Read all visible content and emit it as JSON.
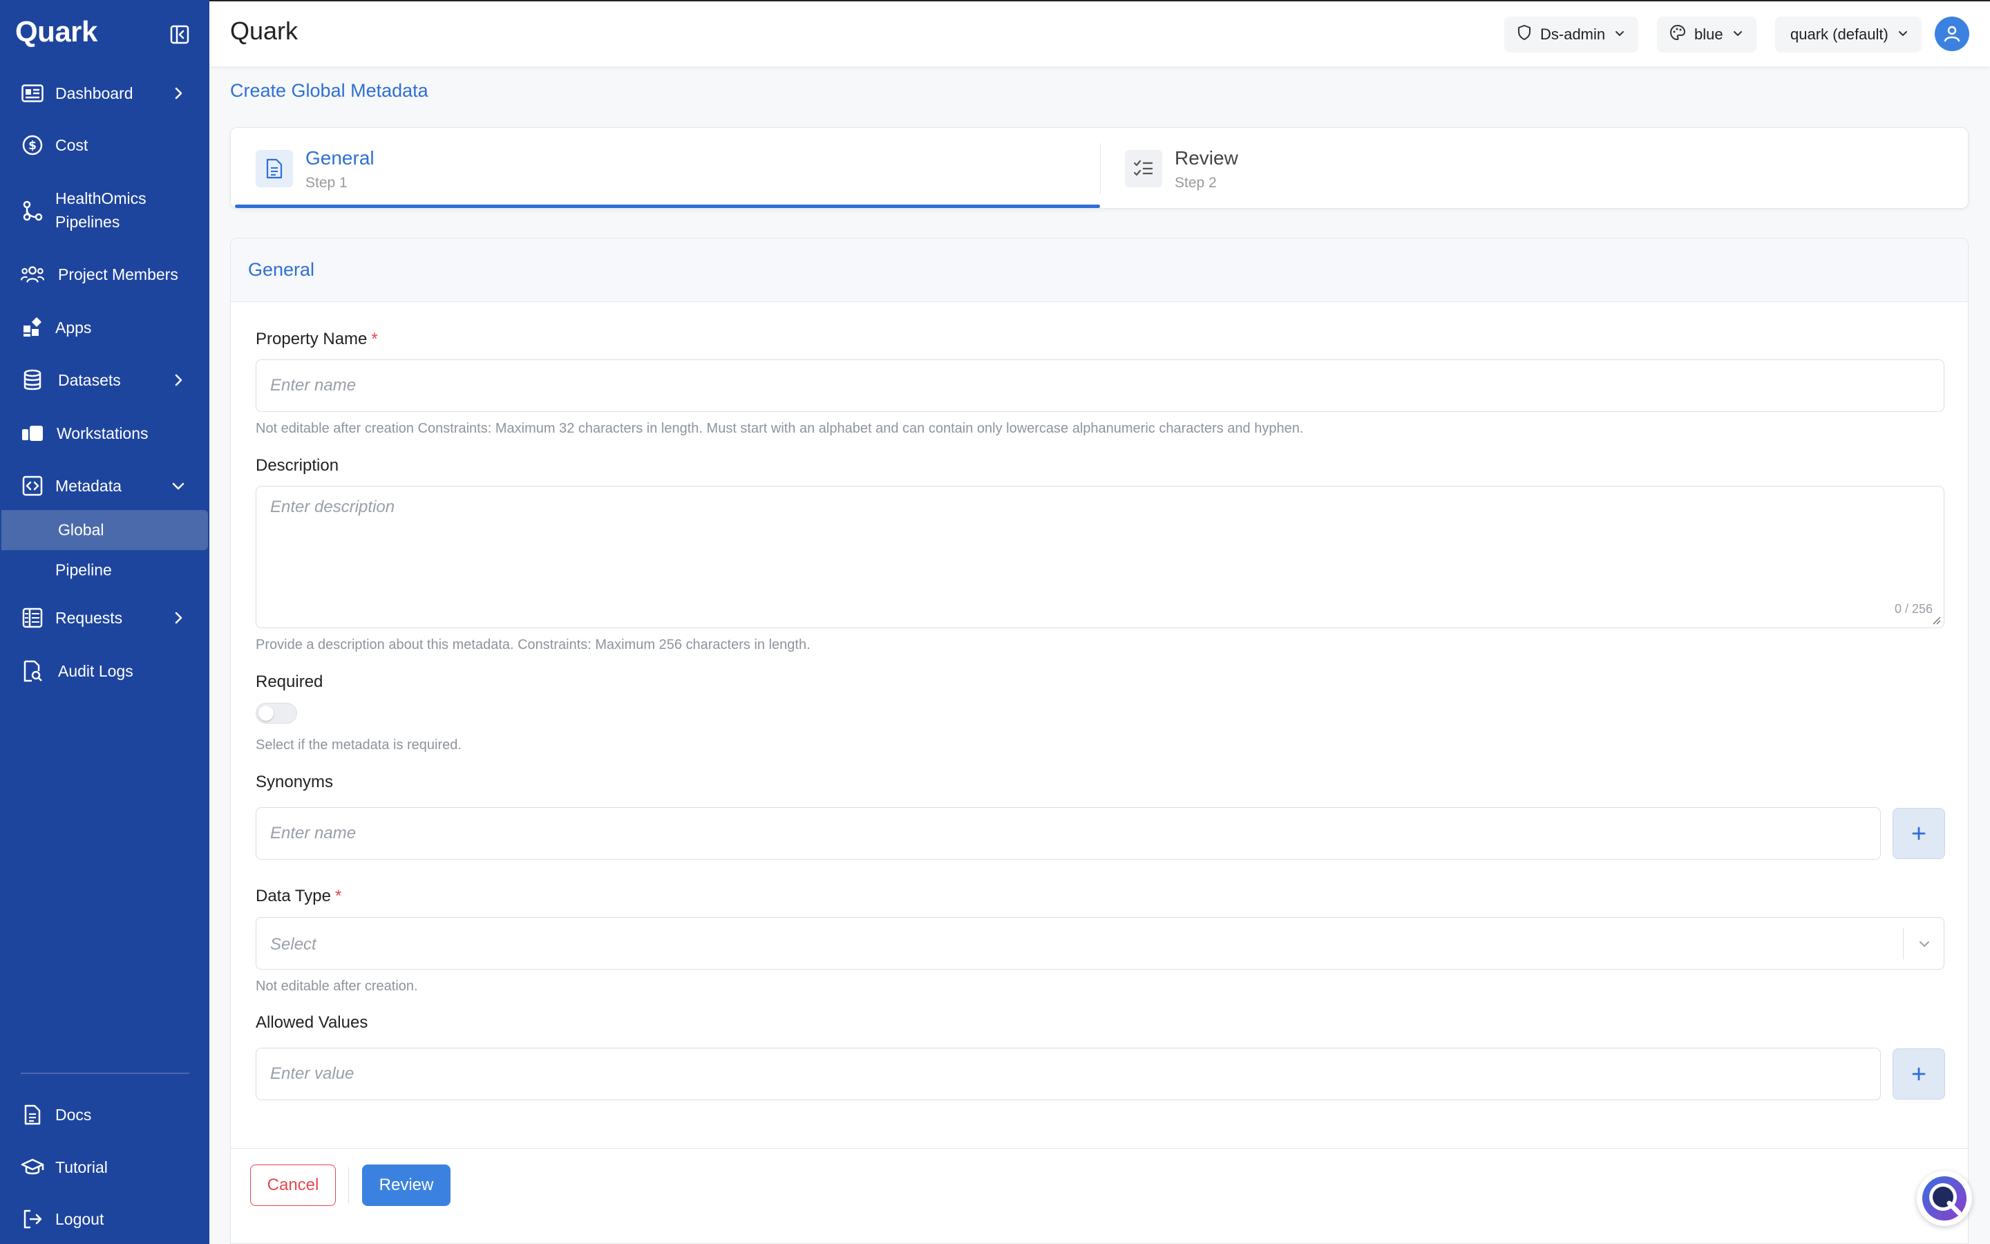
{
  "sidebar": {
    "brand": "Quark",
    "items": [
      {
        "label": "Dashboard",
        "icon": "dashboard-icon"
      },
      {
        "label": "Cost",
        "icon": "dollar-icon"
      },
      {
        "label": "HealthOmics Pipelines",
        "icon": "pipeline-icon"
      },
      {
        "label": "Project Members",
        "icon": "users-icon"
      },
      {
        "label": "Apps",
        "icon": "apps-icon"
      },
      {
        "label": "Datasets",
        "icon": "database-icon"
      },
      {
        "label": "Workstations",
        "icon": "workstation-icon"
      },
      {
        "label": "Metadata",
        "icon": "code-icon"
      },
      {
        "label": "Requests",
        "icon": "list-icon"
      },
      {
        "label": "Audit Logs",
        "icon": "audit-icon"
      }
    ],
    "metadata_sub": [
      {
        "label": "Global",
        "active": true
      },
      {
        "label": "Pipeline",
        "active": false
      }
    ],
    "bottom_items": [
      {
        "label": "Docs",
        "icon": "doc-icon"
      },
      {
        "label": "Tutorial",
        "icon": "graduation-icon"
      },
      {
        "label": "Logout",
        "icon": "logout-icon"
      }
    ]
  },
  "header": {
    "title": "Quark",
    "role": "Ds-admin",
    "theme": "blue",
    "project": "quark (default)"
  },
  "breadcrumb": "Create Global Metadata",
  "stepper": {
    "steps": [
      {
        "title": "General",
        "sub": "Step 1",
        "active": true
      },
      {
        "title": "Review",
        "sub": "Step 2",
        "active": false
      }
    ]
  },
  "form": {
    "section_title": "General",
    "property_name": {
      "label": "Property Name",
      "required_mark": "*",
      "placeholder": "Enter name",
      "value": "",
      "hint": "Not editable after creation Constraints: Maximum 32 characters in length. Must start with an alphabet and can contain only lowercase alphanumeric characters and hyphen."
    },
    "description": {
      "label": "Description",
      "placeholder": "Enter description",
      "value": "",
      "counter": "0 / 256",
      "hint": "Provide a description about this metadata. Constraints: Maximum 256 characters in length."
    },
    "required": {
      "label": "Required",
      "on": false,
      "hint": "Select if the metadata is required."
    },
    "synonyms": {
      "label": "Synonyms",
      "placeholder": "Enter name",
      "value": ""
    },
    "data_type": {
      "label": "Data Type",
      "required_mark": "*",
      "placeholder": "Select",
      "hint": "Not editable after creation."
    },
    "allowed_values": {
      "label": "Allowed Values",
      "placeholder": "Enter value",
      "value": ""
    },
    "cancel_label": "Cancel",
    "review_label": "Review"
  },
  "colors": {
    "sidebar_bg": "#1e459e",
    "accent": "#3b82e0",
    "danger": "#e5484d"
  }
}
